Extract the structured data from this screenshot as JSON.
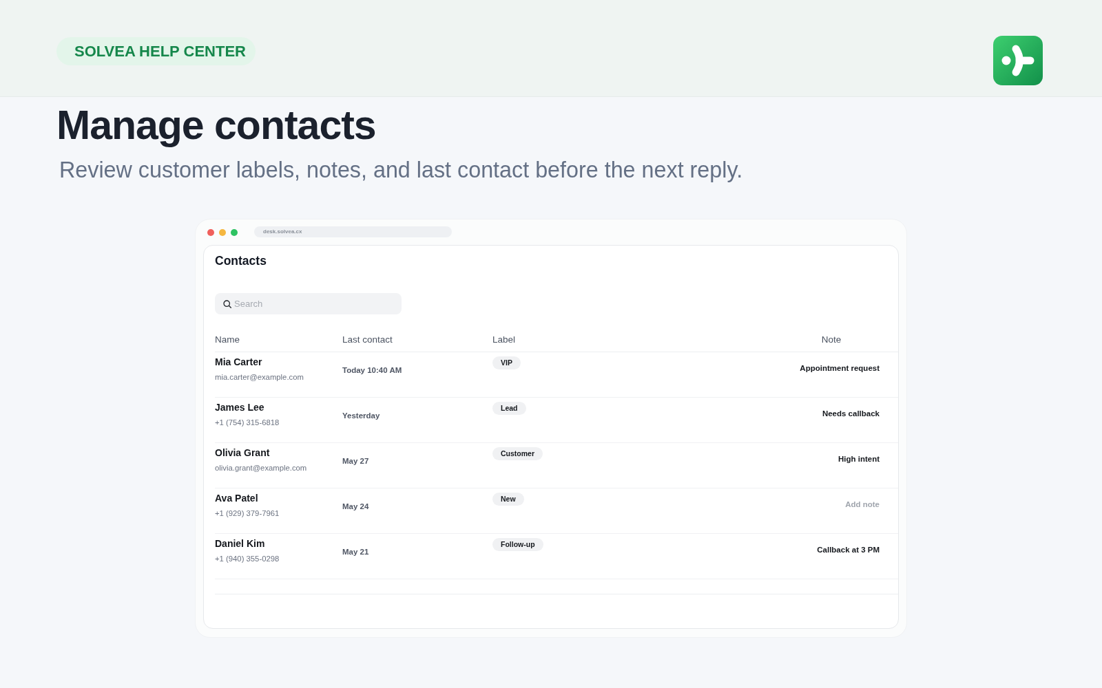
{
  "header": {
    "badge": "SOLVEA HELP CENTER"
  },
  "title": "Manage contacts",
  "subtitle": "Review customer labels, notes, and last contact before the next reply.",
  "browser": {
    "url": "desk.solvea.cx"
  },
  "app": {
    "title": "Contacts",
    "search": {
      "placeholder": "Search"
    },
    "table": {
      "columns": [
        "Name",
        "Last contact",
        "Label",
        "Note"
      ],
      "rows": [
        {
          "name": "Mia Carter",
          "detail": "mia.carter@example.com",
          "last_contact": "Today 10:40 AM",
          "label": "VIP",
          "note": {
            "kind": "text",
            "text": "Appointment request"
          }
        },
        {
          "name": "James Lee",
          "detail": "+1 (754) 315-6818",
          "last_contact": "Yesterday",
          "label": "Lead",
          "note": {
            "kind": "text",
            "text": "Needs callback"
          }
        },
        {
          "name": "Olivia Grant",
          "detail": "olivia.grant@example.com",
          "last_contact": "May 27",
          "label": "Customer",
          "note": {
            "kind": "text",
            "text": "High intent"
          }
        },
        {
          "name": "Ava Patel",
          "detail": "+1 (929) 379-7961",
          "last_contact": "May 24",
          "label": "New",
          "note": {
            "kind": "action",
            "text": "Add note"
          }
        },
        {
          "name": "Daniel Kim",
          "detail": "+1 (940) 355-0298",
          "last_contact": "May 21",
          "label": "Follow-up",
          "note": {
            "kind": "text",
            "text": "Callback at 3 PM"
          }
        }
      ]
    }
  }
}
